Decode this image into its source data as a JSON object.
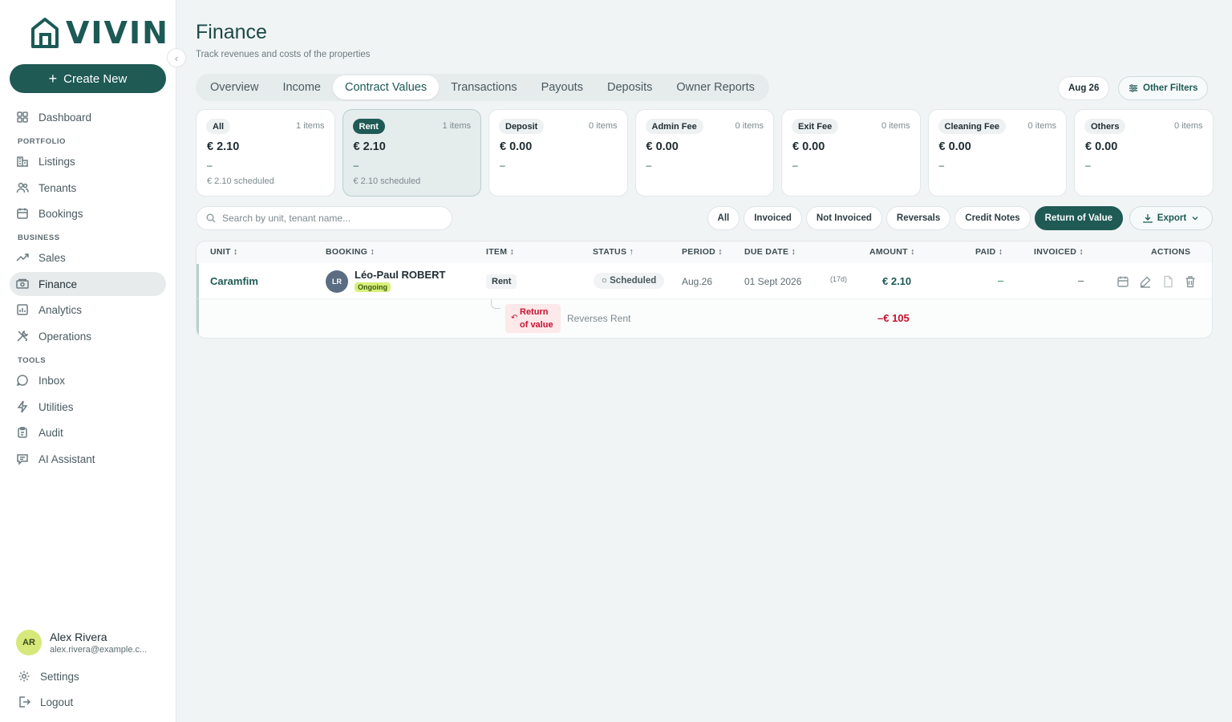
{
  "brand": {
    "name": "VIVIN"
  },
  "sidebar": {
    "create_label": "Create New",
    "sections": {
      "portfolio": "PORTFOLIO",
      "business": "BUSINESS",
      "tools": "TOOLS"
    },
    "items": {
      "dashboard": "Dashboard",
      "listings": "Listings",
      "tenants": "Tenants",
      "bookings": "Bookings",
      "sales": "Sales",
      "finance": "Finance",
      "analytics": "Analytics",
      "operations": "Operations",
      "inbox": "Inbox",
      "utilities": "Utilities",
      "audit": "Audit",
      "ai_assistant": "AI Assistant"
    },
    "user": {
      "initials": "AR",
      "name": "Alex Rivera",
      "email": "alex.rivera@example.c..."
    },
    "settings": "Settings",
    "logout": "Logout"
  },
  "header": {
    "title": "Finance",
    "subtitle": "Track revenues and costs of the properties",
    "tabs": [
      "Overview",
      "Income",
      "Contract Values",
      "Transactions",
      "Payouts",
      "Deposits",
      "Owner Reports"
    ],
    "active_tab": "Contract Values",
    "date_filter": "Aug 26",
    "other_filters": "Other Filters"
  },
  "cards": [
    {
      "label": "All",
      "count": "1 items",
      "amount": "€ 2.10",
      "dash": "–",
      "scheduled": "€ 2.10 scheduled"
    },
    {
      "label": "Rent",
      "count": "1 items",
      "amount": "€ 2.10",
      "dash": "–",
      "scheduled": "€ 2.10 scheduled"
    },
    {
      "label": "Deposit",
      "count": "0 items",
      "amount": "€ 0.00",
      "dash": "–",
      "scheduled": ""
    },
    {
      "label": "Admin Fee",
      "count": "0 items",
      "amount": "€ 0.00",
      "dash": "–",
      "scheduled": ""
    },
    {
      "label": "Exit Fee",
      "count": "0 items",
      "amount": "€ 0.00",
      "dash": "–",
      "scheduled": ""
    },
    {
      "label": "Cleaning Fee",
      "count": "0 items",
      "amount": "€ 0.00",
      "dash": "–",
      "scheduled": ""
    },
    {
      "label": "Others",
      "count": "0 items",
      "amount": "€ 0.00",
      "dash": "–",
      "scheduled": ""
    }
  ],
  "search": {
    "placeholder": "Search by unit, tenant name..."
  },
  "filter_chips": [
    "All",
    "Invoiced",
    "Not Invoiced",
    "Reversals",
    "Credit Notes",
    "Return of Value"
  ],
  "active_chip": "Return of Value",
  "export_label": "Export",
  "table": {
    "columns": {
      "unit": "UNIT ↕",
      "booking": "BOOKING ↕",
      "item": "ITEM ↕",
      "status": "STATUS ↑",
      "period": "PERIOD ↕",
      "due_date": "DUE DATE ↕",
      "amount": "AMOUNT ↕",
      "paid": "PAID ↕",
      "invoiced": "INVOICED ↕",
      "actions": "ACTIONS"
    },
    "row": {
      "unit": "Caramfim",
      "booking_initials": "LR",
      "booking_name": "Léo-Paul ROBERT",
      "booking_status": "Ongoing",
      "item": "Rent",
      "status": "○ Scheduled",
      "period": "Aug.26",
      "due_date": "01 Sept 2026",
      "due_days": "(17d)",
      "amount": "€ 2.10",
      "paid": "–",
      "invoiced": "–"
    },
    "sub_row": {
      "tag_line1": "Return",
      "tag_line2": "of value",
      "description": "Reverses Rent",
      "amount": "–€ 105"
    }
  },
  "colors": {
    "brand": "#1f5a55",
    "negative": "#c8102e",
    "ongoing": "#d8ef7a"
  }
}
